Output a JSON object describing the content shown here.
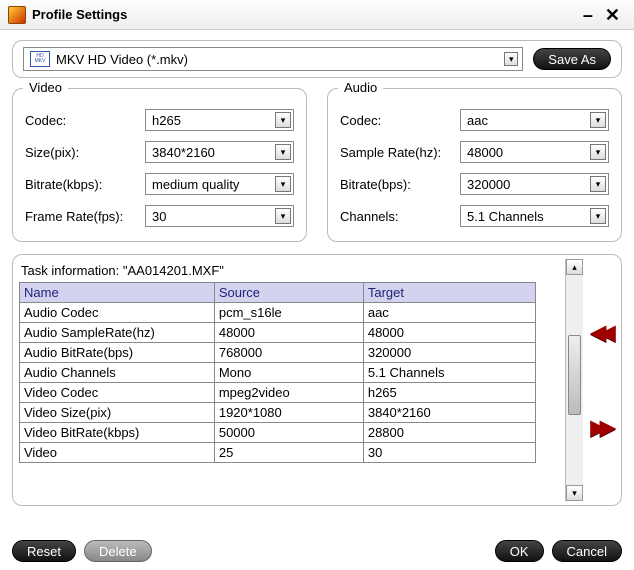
{
  "titlebar": {
    "title": "Profile Settings"
  },
  "profile": {
    "icon_top": "HD",
    "icon_bottom": "MKV",
    "selected": "MKV HD Video (*.mkv)",
    "save_as": "Save As"
  },
  "video": {
    "legend": "Video",
    "codec_label": "Codec:",
    "codec": "h265",
    "size_label": "Size(pix):",
    "size": "3840*2160",
    "bitrate_label": "Bitrate(kbps):",
    "bitrate": "medium quality",
    "fps_label": "Frame Rate(fps):",
    "fps": "30"
  },
  "audio": {
    "legend": "Audio",
    "codec_label": "Codec:",
    "codec": "aac",
    "rate_label": "Sample Rate(hz):",
    "rate": "48000",
    "bitrate_label": "Bitrate(bps):",
    "bitrate": "320000",
    "ch_label": "Channels:",
    "ch": "5.1 Channels"
  },
  "task": {
    "caption": "Task information: \"AA014201.MXF\"",
    "headers": {
      "name": "Name",
      "source": "Source",
      "target": "Target"
    },
    "rows": [
      {
        "name": "Audio Codec",
        "source": "pcm_s16le",
        "target": "aac"
      },
      {
        "name": "Audio SampleRate(hz)",
        "source": "48000",
        "target": "48000"
      },
      {
        "name": "Audio BitRate(bps)",
        "source": "768000",
        "target": "320000"
      },
      {
        "name": "Audio Channels",
        "source": "Mono",
        "target": "5.1 Channels"
      },
      {
        "name": "Video Codec",
        "source": "mpeg2video",
        "target": "h265"
      },
      {
        "name": "Video Size(pix)",
        "source": "1920*1080",
        "target": "3840*2160"
      },
      {
        "name": "Video BitRate(kbps)",
        "source": "50000",
        "target": "28800"
      },
      {
        "name": "Video",
        "source": "25",
        "target": "30"
      }
    ]
  },
  "footer": {
    "reset": "Reset",
    "delete": "Delete",
    "ok": "OK",
    "cancel": "Cancel"
  }
}
